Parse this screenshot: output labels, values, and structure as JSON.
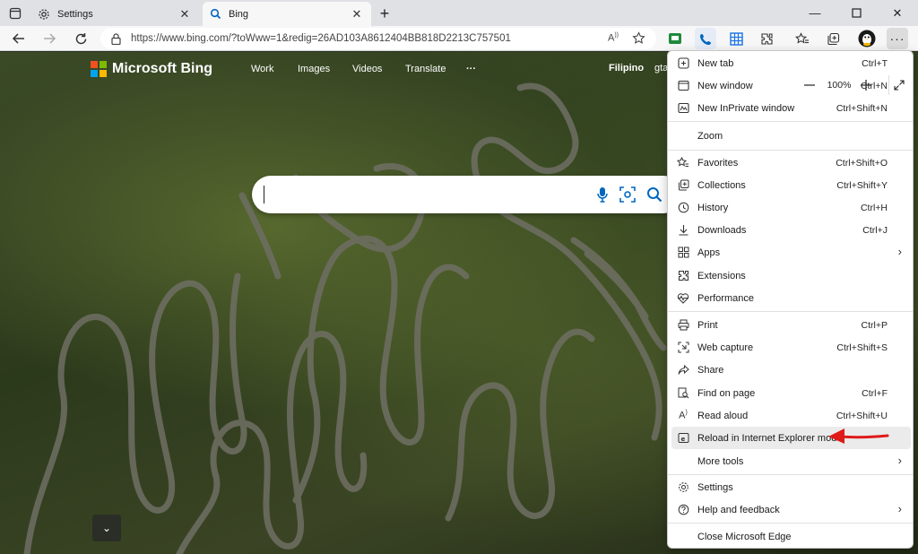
{
  "tabs": [
    {
      "title": "Settings",
      "icon": "gear-icon"
    },
    {
      "title": "Bing",
      "icon": "search-icon"
    }
  ],
  "address": {
    "url": "https://www.bing.com/?toWww=1&redig=26AD103A8612404BB818D2213C757501"
  },
  "bing": {
    "logo_text": "Microsoft Bing",
    "nav": [
      "Work",
      "Images",
      "Videos",
      "Translate",
      "···"
    ],
    "language": "Filipino",
    "user_partial": "gta"
  },
  "menu": {
    "items": [
      {
        "label": "New tab",
        "shortcut": "Ctrl+T",
        "icon": "new-tab-icon"
      },
      {
        "label": "New window",
        "shortcut": "Ctrl+N",
        "icon": "new-window-icon"
      },
      {
        "label": "New InPrivate window",
        "shortcut": "Ctrl+Shift+N",
        "icon": "inprivate-icon"
      },
      {
        "label": "Favorites",
        "shortcut": "Ctrl+Shift+O",
        "icon": "star-icon"
      },
      {
        "label": "Collections",
        "shortcut": "Ctrl+Shift+Y",
        "icon": "collections-icon"
      },
      {
        "label": "History",
        "shortcut": "Ctrl+H",
        "icon": "history-icon"
      },
      {
        "label": "Downloads",
        "shortcut": "Ctrl+J",
        "icon": "download-icon"
      },
      {
        "label": "Apps",
        "shortcut": "",
        "icon": "apps-icon"
      },
      {
        "label": "Extensions",
        "shortcut": "",
        "icon": "puzzle-icon"
      },
      {
        "label": "Performance",
        "shortcut": "",
        "icon": "heartbeat-icon"
      },
      {
        "label": "Print",
        "shortcut": "Ctrl+P",
        "icon": "print-icon"
      },
      {
        "label": "Web capture",
        "shortcut": "Ctrl+Shift+S",
        "icon": "capture-icon"
      },
      {
        "label": "Share",
        "shortcut": "",
        "icon": "share-icon"
      },
      {
        "label": "Find on page",
        "shortcut": "Ctrl+F",
        "icon": "find-icon"
      },
      {
        "label": "Read aloud",
        "shortcut": "Ctrl+Shift+U",
        "icon": "read-aloud-icon"
      },
      {
        "label": "Reload in Internet Explorer mode",
        "shortcut": "",
        "icon": "ie-mode-icon"
      },
      {
        "label": "More tools",
        "shortcut": "",
        "icon": ""
      },
      {
        "label": "Settings",
        "shortcut": "",
        "icon": "gear-icon"
      },
      {
        "label": "Help and feedback",
        "shortcut": "",
        "icon": "help-icon"
      },
      {
        "label": "Close Microsoft Edge",
        "shortcut": "",
        "icon": ""
      }
    ],
    "zoom": {
      "label": "Zoom",
      "value": "100%",
      "minus": "—",
      "plus": "+"
    }
  },
  "colors": {
    "accent": "#0067c0",
    "annotation_arrow": "#e01a1a"
  }
}
